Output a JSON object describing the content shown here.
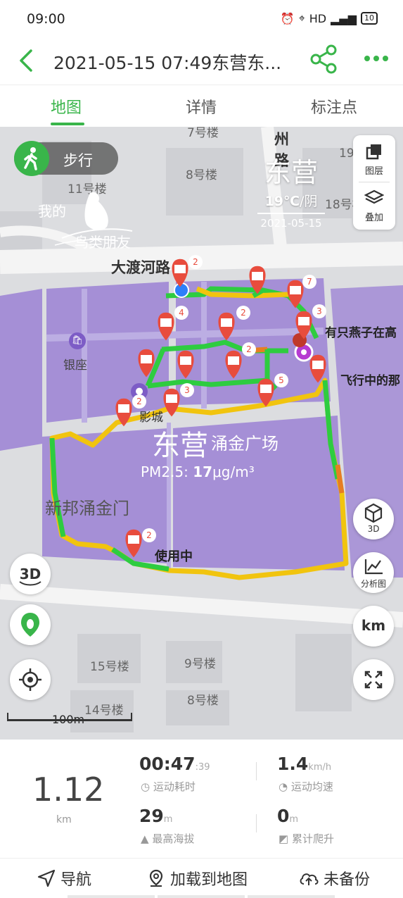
{
  "status_bar": {
    "time": "09:00",
    "network": "HD",
    "signal": "⁴⁶ᴳ",
    "battery": "10"
  },
  "header": {
    "title": "2021-05-15 07:49东营东..."
  },
  "tabs": [
    {
      "label": "地图",
      "active": true
    },
    {
      "label": "详情",
      "active": false
    },
    {
      "label": "标注点",
      "active": false
    }
  ],
  "map": {
    "mode_label": "步行",
    "city": "东营",
    "weather_temp": "19℃",
    "weather_cond": "/阴",
    "date": "2021-05-15",
    "layer_label": "图层",
    "overlay_label": "叠加",
    "watermark_line1": "我的",
    "watermark_line2": "鸟类朋友",
    "center_label": "东营",
    "pm_prefix": "PM2.5: ",
    "pm_value": "17",
    "pm_unit": "μg/m³",
    "in_use": "使用中",
    "poi_swallow": "有只燕子在高",
    "poi_flying": "飞行中的那",
    "poi_yinzuo": "银座",
    "poi_cinema": "影城",
    "road_dadu": "大渡河路",
    "area_main": "涌金广场",
    "area_gate": "新邦涌金门",
    "road_zhou": "州路",
    "buildings": [
      "7号楼",
      "8号楼",
      "11号楼",
      "19",
      "18号楼",
      "15号楼",
      "9号楼",
      "14号楼",
      "8号楼"
    ],
    "pin_counts": [
      "2",
      "7",
      "3",
      "4",
      "2",
      "2",
      "5",
      "3",
      "2",
      "2"
    ],
    "btn_3d": "3D",
    "btn_analysis": "分析图",
    "btn_km": "km",
    "scale_label": "100m"
  },
  "stats": {
    "distance": "1.12",
    "distance_unit": "km",
    "duration": "00:47",
    "duration_sec": ":39",
    "duration_label": "运动耗时",
    "avg_speed": "1.4",
    "avg_speed_unit": "km/h",
    "avg_speed_label": "运动均速",
    "max_alt": "29",
    "max_alt_unit": "m",
    "max_alt_label": "最高海拔",
    "climb": "0",
    "climb_unit": "m",
    "climb_label": "累计爬升"
  },
  "bottom_bar": {
    "nav": "导航",
    "load": "加载到地图",
    "backup": "未备份"
  },
  "colors": {
    "accent": "#39b54a",
    "pin": "#e84c3d",
    "block": "#a58fd6",
    "route_fast": "#2ecc40",
    "route_slow": "#f1c40f"
  }
}
